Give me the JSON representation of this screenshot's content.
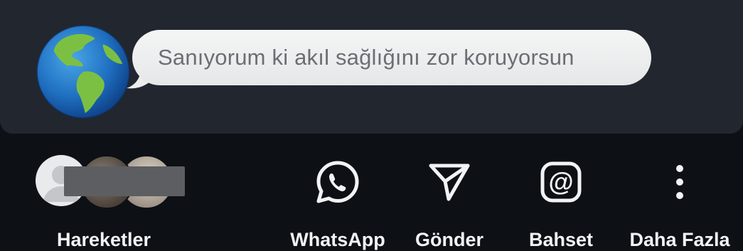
{
  "message": {
    "text": "Sanıyorum ki akıl sağlığını zor koruyorsun"
  },
  "share": {
    "items": [
      {
        "label": "Hareketler",
        "icon": "avatars-stack"
      },
      {
        "label": "WhatsApp",
        "icon": "whatsapp-icon"
      },
      {
        "label": "Gönder",
        "icon": "send-icon"
      },
      {
        "label": "Bahset",
        "icon": "at-icon"
      },
      {
        "label": "Daha Fazla",
        "icon": "more-vertical-icon"
      }
    ]
  },
  "colors": {
    "card_bg": "#22262f",
    "page_bg": "#0d1015",
    "bubble_bg": "#eeeeef",
    "bubble_text": "#6b6e73",
    "label_text": "#f2f3f5"
  }
}
